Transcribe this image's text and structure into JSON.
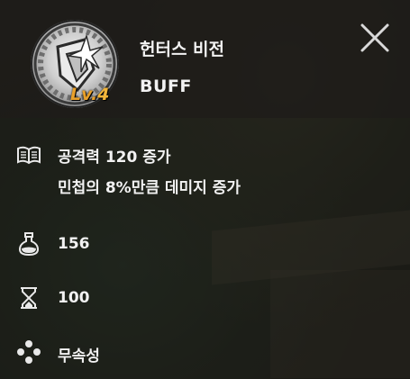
{
  "skill": {
    "name": "헌터스 비전",
    "type": "BUFF",
    "level_prefix": "Lv.",
    "level": "4"
  },
  "effects": [
    "공격력 120 증가",
    "민첩의 8%만큼 데미지 증가"
  ],
  "stats": {
    "mana_cost": "156",
    "duration": "100",
    "element": "무속성"
  },
  "icons": {
    "skill": "hunters-vision-skill-icon",
    "effects": "book-icon",
    "mana": "potion-icon",
    "duration": "hourglass-icon",
    "element": "element-dots-icon",
    "close": "close-icon"
  },
  "colors": {
    "level": "#f2b53a",
    "text": "#f2f2f2"
  }
}
